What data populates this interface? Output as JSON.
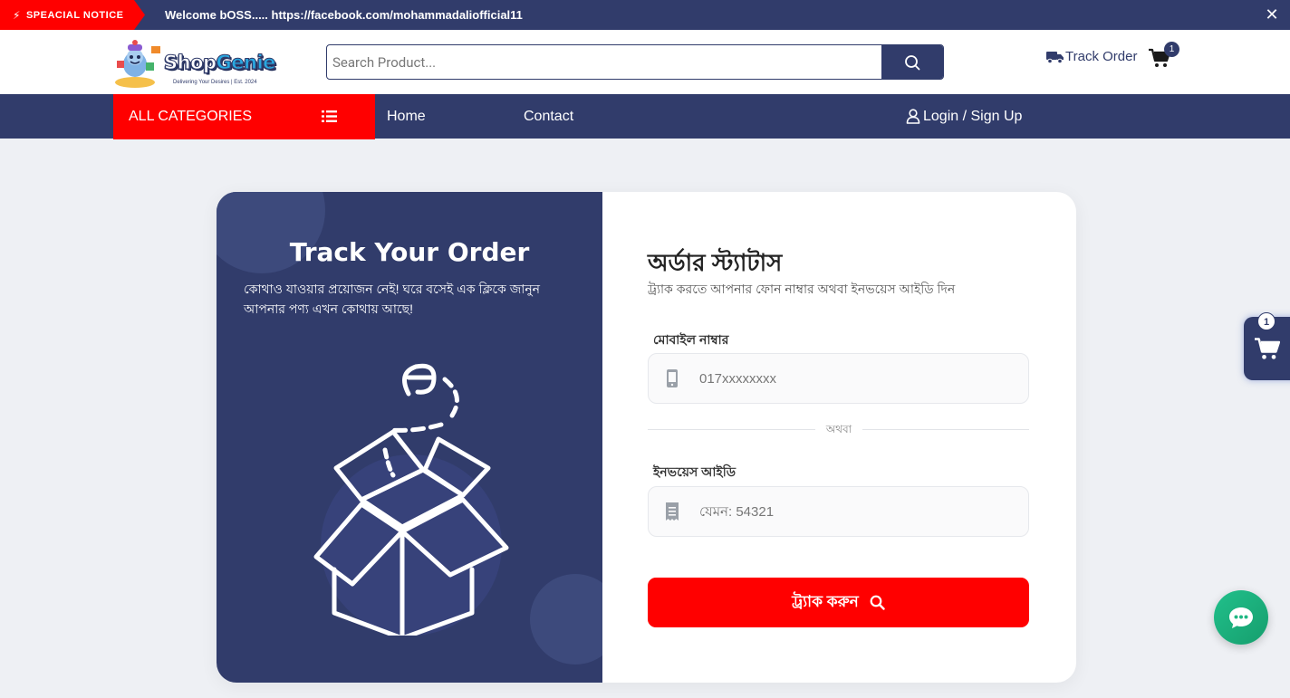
{
  "notice": {
    "tag": "SPEACIAL NOTICE",
    "text": "Welcome bOSS..... https://facebook.com/mohammadaliofficial11",
    "close": "✕"
  },
  "header": {
    "logo": {
      "word_a": "Shop",
      "word_b": "Genie",
      "tagline": "Delivering Your Desires | Est. 2024"
    },
    "search_placeholder": "Search Product...",
    "track_order": "Track Order",
    "cart_count": "1"
  },
  "nav": {
    "all_categories": "ALL CATEGORIES",
    "links": [
      "Home",
      "Contact"
    ],
    "login": "Login / Sign Up"
  },
  "left_panel": {
    "title": "Track Your Order",
    "description": "কোথাও যাওয়ার প্রয়োজন নেই! ঘরে বসেই এক ক্লিকে জানুন আপনার পণ্য এখন কোথায় আছে!"
  },
  "form": {
    "title": "অর্ডার স্ট্যাটাস",
    "subtitle": "ট্র্যাক করতে আপনার ফোন নাম্বার অথবা ইনভয়েস আইডি দিন",
    "mobile_label": "মোবাইল নাম্বার",
    "mobile_placeholder": "017xxxxxxxx",
    "or_text": "অথবা",
    "invoice_label": "ইনভয়েস আইডি",
    "invoice_placeholder": "যেমন: 54321",
    "submit": "ট্র্যাক করুন"
  },
  "floating": {
    "cart_count": "1"
  },
  "colors": {
    "primary": "#313c6b",
    "accent": "#ff0000",
    "chat": "#1fb883"
  }
}
